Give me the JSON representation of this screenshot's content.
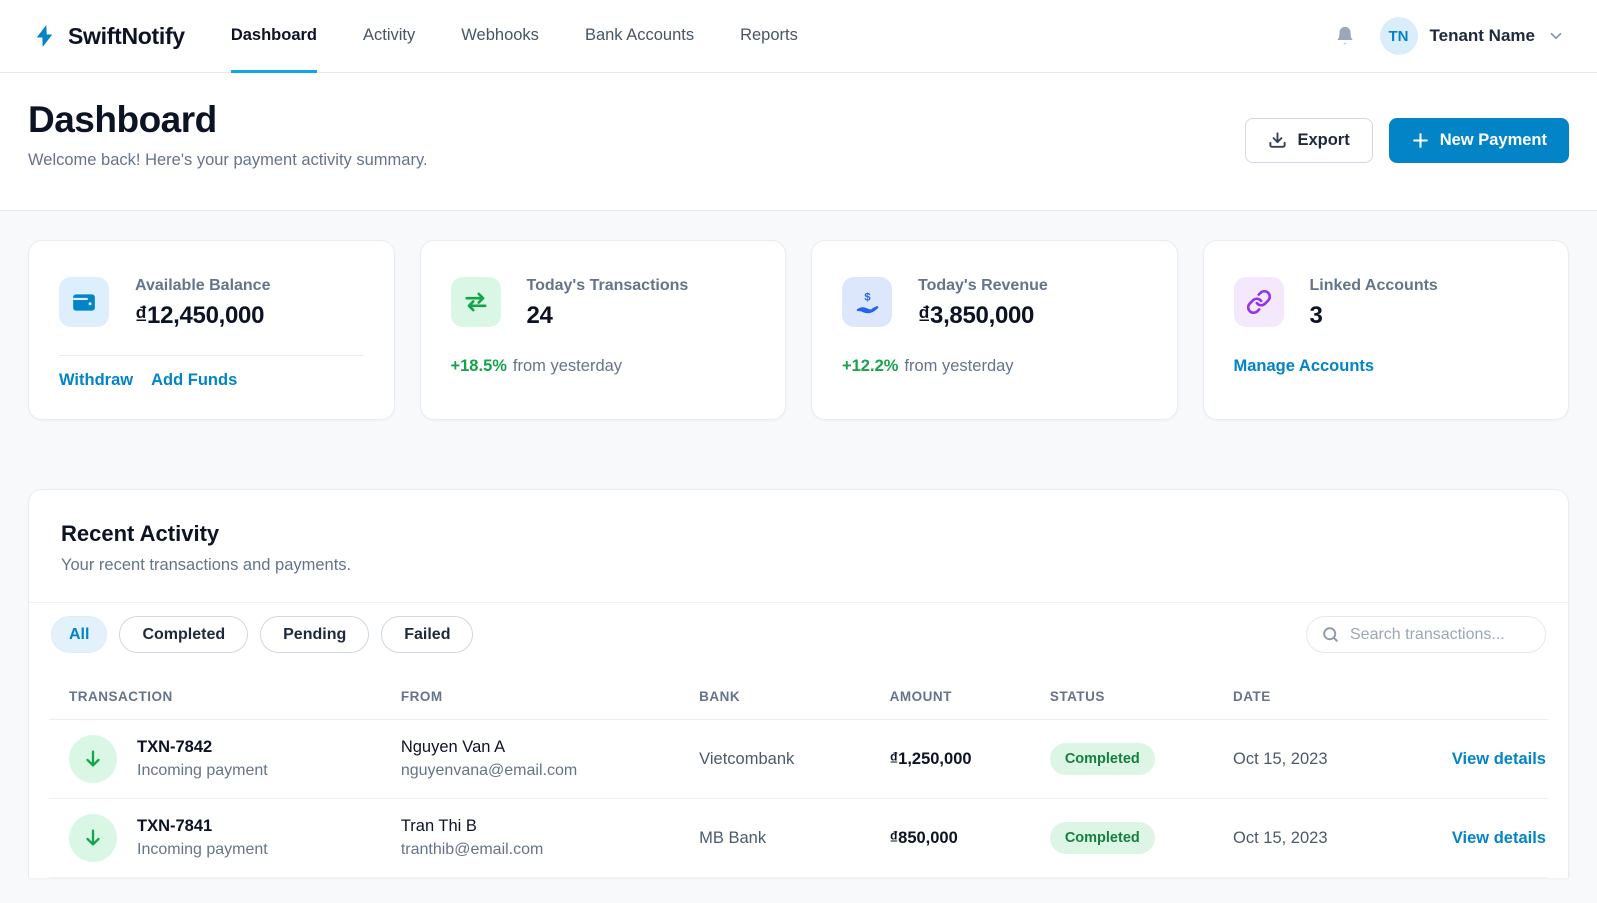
{
  "colors": {
    "accent_blue": "#0284c7",
    "active_tab_underline": "#0ea5e9",
    "green": "#16a34a",
    "purple": "#9333ea",
    "indigo": "#2563eb",
    "status_badge_bg": "#dcf5e5",
    "status_badge_text": "#15803d",
    "page_bg": "#f7f9fb"
  },
  "nav": {
    "brand": "SwiftNotify",
    "items": [
      {
        "label": "Dashboard",
        "active": true
      },
      {
        "label": "Activity",
        "active": false
      },
      {
        "label": "Webhooks",
        "active": false
      },
      {
        "label": "Bank Accounts",
        "active": false
      },
      {
        "label": "Reports",
        "active": false
      }
    ],
    "user": {
      "initials": "TN",
      "name": "Tenant Name"
    }
  },
  "header": {
    "title": "Dashboard",
    "subtitle": "Welcome back! Here's your payment activity summary.",
    "export_label": "Export",
    "new_payment_label": "New Payment"
  },
  "stats": {
    "cards": [
      {
        "icon": "wallet-icon",
        "label": "Available Balance",
        "value": "₫12,450,000",
        "links": {
          "withdraw": "Withdraw",
          "add_funds": "Add Funds"
        }
      },
      {
        "icon": "transfer-arrows-icon",
        "label": "Today's Transactions",
        "value": "24",
        "delta": "+18.5%",
        "delta_suffix": "from yesterday"
      },
      {
        "icon": "hand-dollar-icon",
        "label": "Today's Revenue",
        "value": "₫3,850,000",
        "delta": "+12.2%",
        "delta_suffix": "from yesterday"
      },
      {
        "icon": "chain-link-icon",
        "label": "Linked Accounts",
        "value": "3",
        "link": "Manage Accounts"
      }
    ]
  },
  "activity": {
    "title": "Recent Activity",
    "subtitle": "Your recent transactions and payments.",
    "filters": [
      "All",
      "Completed",
      "Pending",
      "Failed"
    ],
    "active_filter": "All",
    "search_placeholder": "Search transactions...",
    "columns": [
      "Transaction",
      "From",
      "Bank",
      "Amount",
      "Status",
      "Date"
    ],
    "rows": [
      {
        "id": "TXN-7842",
        "type": "Incoming payment",
        "from_name": "Nguyen Van A",
        "from_email": "nguyenvana@email.com",
        "bank": "Vietcombank",
        "amount": "₫1,250,000",
        "status": "Completed",
        "date": "Oct 15, 2023",
        "action": "View details"
      },
      {
        "id": "TXN-7841",
        "type": "Incoming payment",
        "from_name": "Tran Thi B",
        "from_email": "tranthib@email.com",
        "bank": "MB Bank",
        "amount": "₫850,000",
        "status": "Completed",
        "date": "Oct 15, 2023",
        "action": "View details"
      }
    ]
  }
}
